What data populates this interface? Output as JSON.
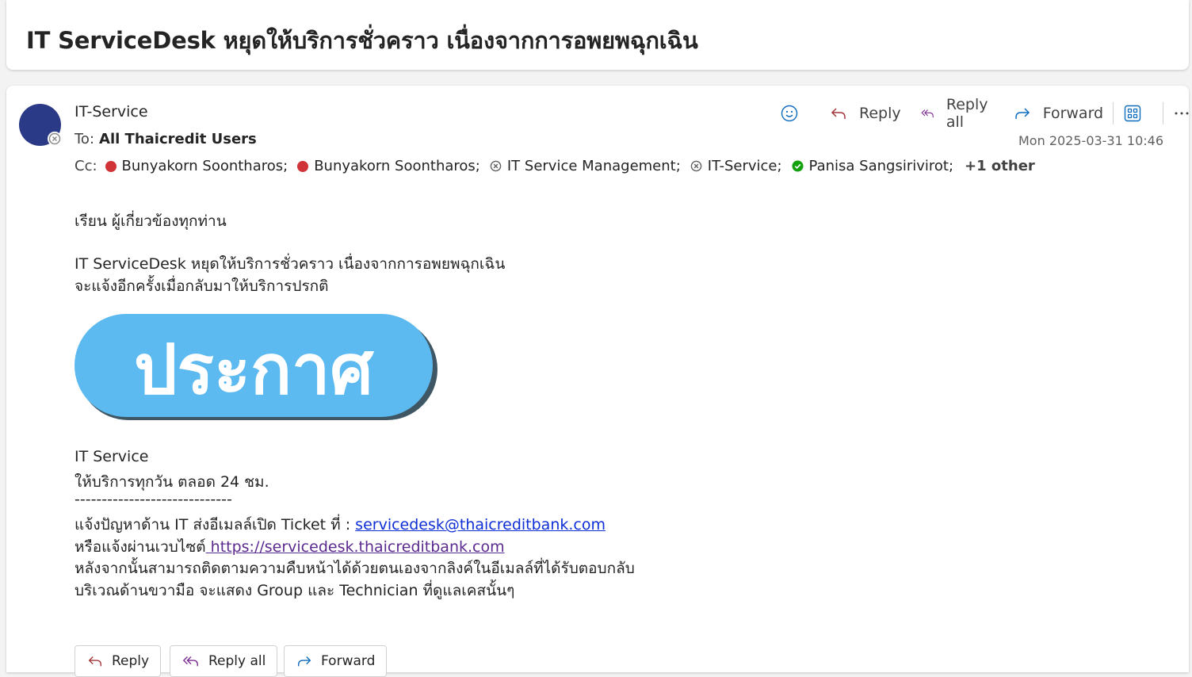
{
  "subject": "IT ServiceDesk หยุดให้บริการชั่วคราว เนื่องจากการอพยพฉุกเฉิน",
  "header": {
    "sender": "IT-Service",
    "to_label": "To:",
    "to_value": "All Thaicredit Users",
    "cc_label": "Cc:",
    "cc": [
      {
        "name": "Bunyakorn Soontharos;",
        "status": "busy"
      },
      {
        "name": "Bunyakorn Soontharos;",
        "status": "busy"
      },
      {
        "name": "IT Service Management;",
        "status": "unknown"
      },
      {
        "name": "IT-Service;",
        "status": "unknown"
      },
      {
        "name": "Panisa Sangsirivirot;",
        "status": "available"
      }
    ],
    "cc_more": "+1 other",
    "timestamp": "Mon 2025-03-31 10:46"
  },
  "actions": {
    "reply": "Reply",
    "reply_all": "Reply all",
    "forward": "Forward"
  },
  "body": {
    "greeting": "เรียน ผู้เกี่ยวข้องทุกท่าน",
    "line1": "IT ServiceDesk หยุดให้บริการชั่วคราว เนื่องจากการอพยพฉุกเฉิน",
    "line2": "จะแจ้งอีกครั้งเมื่อกลับมาให้บริการปรกติ",
    "banner_text": "ประกาศ",
    "sig_name": "IT Service",
    "sig_hours": "ให้บริการทุกวัน ตลอด 24 ชม.",
    "sig_divider": "-----------------------------",
    "sig_email_prefix": "แจ้งปัญหาด้าน IT ส่งอีเมลล์เปิด Ticket ที่ : ",
    "sig_email": "servicedesk@thaicreditbank.com",
    "sig_web_prefix": "หรือแจ้งผ่านเวบไซต์",
    "sig_web": " https://servicedesk.thaicreditbank.com",
    "sig_follow": "หลังจากนั้นสามารถติดตามความคืบหน้าได้ด้วยตนเองจากลิงค์ในอีเมลล์ที่ได้รับตอบกลับ",
    "sig_right": "บริเวณด้านขวามือ จะแสดง Group และ Technician ที่ดูแลเคสนั้นๆ"
  },
  "bottom_actions": {
    "reply": "Reply",
    "reply_all": "Reply all",
    "forward": "Forward"
  },
  "colors": {
    "avatar": "#2b3a86",
    "banner": "#5cbaf0",
    "link": "#0f2fd6",
    "visited_link": "#5b2a8e",
    "reply_all_icon": "#7b2d91",
    "accent": "#0f6cbd"
  }
}
